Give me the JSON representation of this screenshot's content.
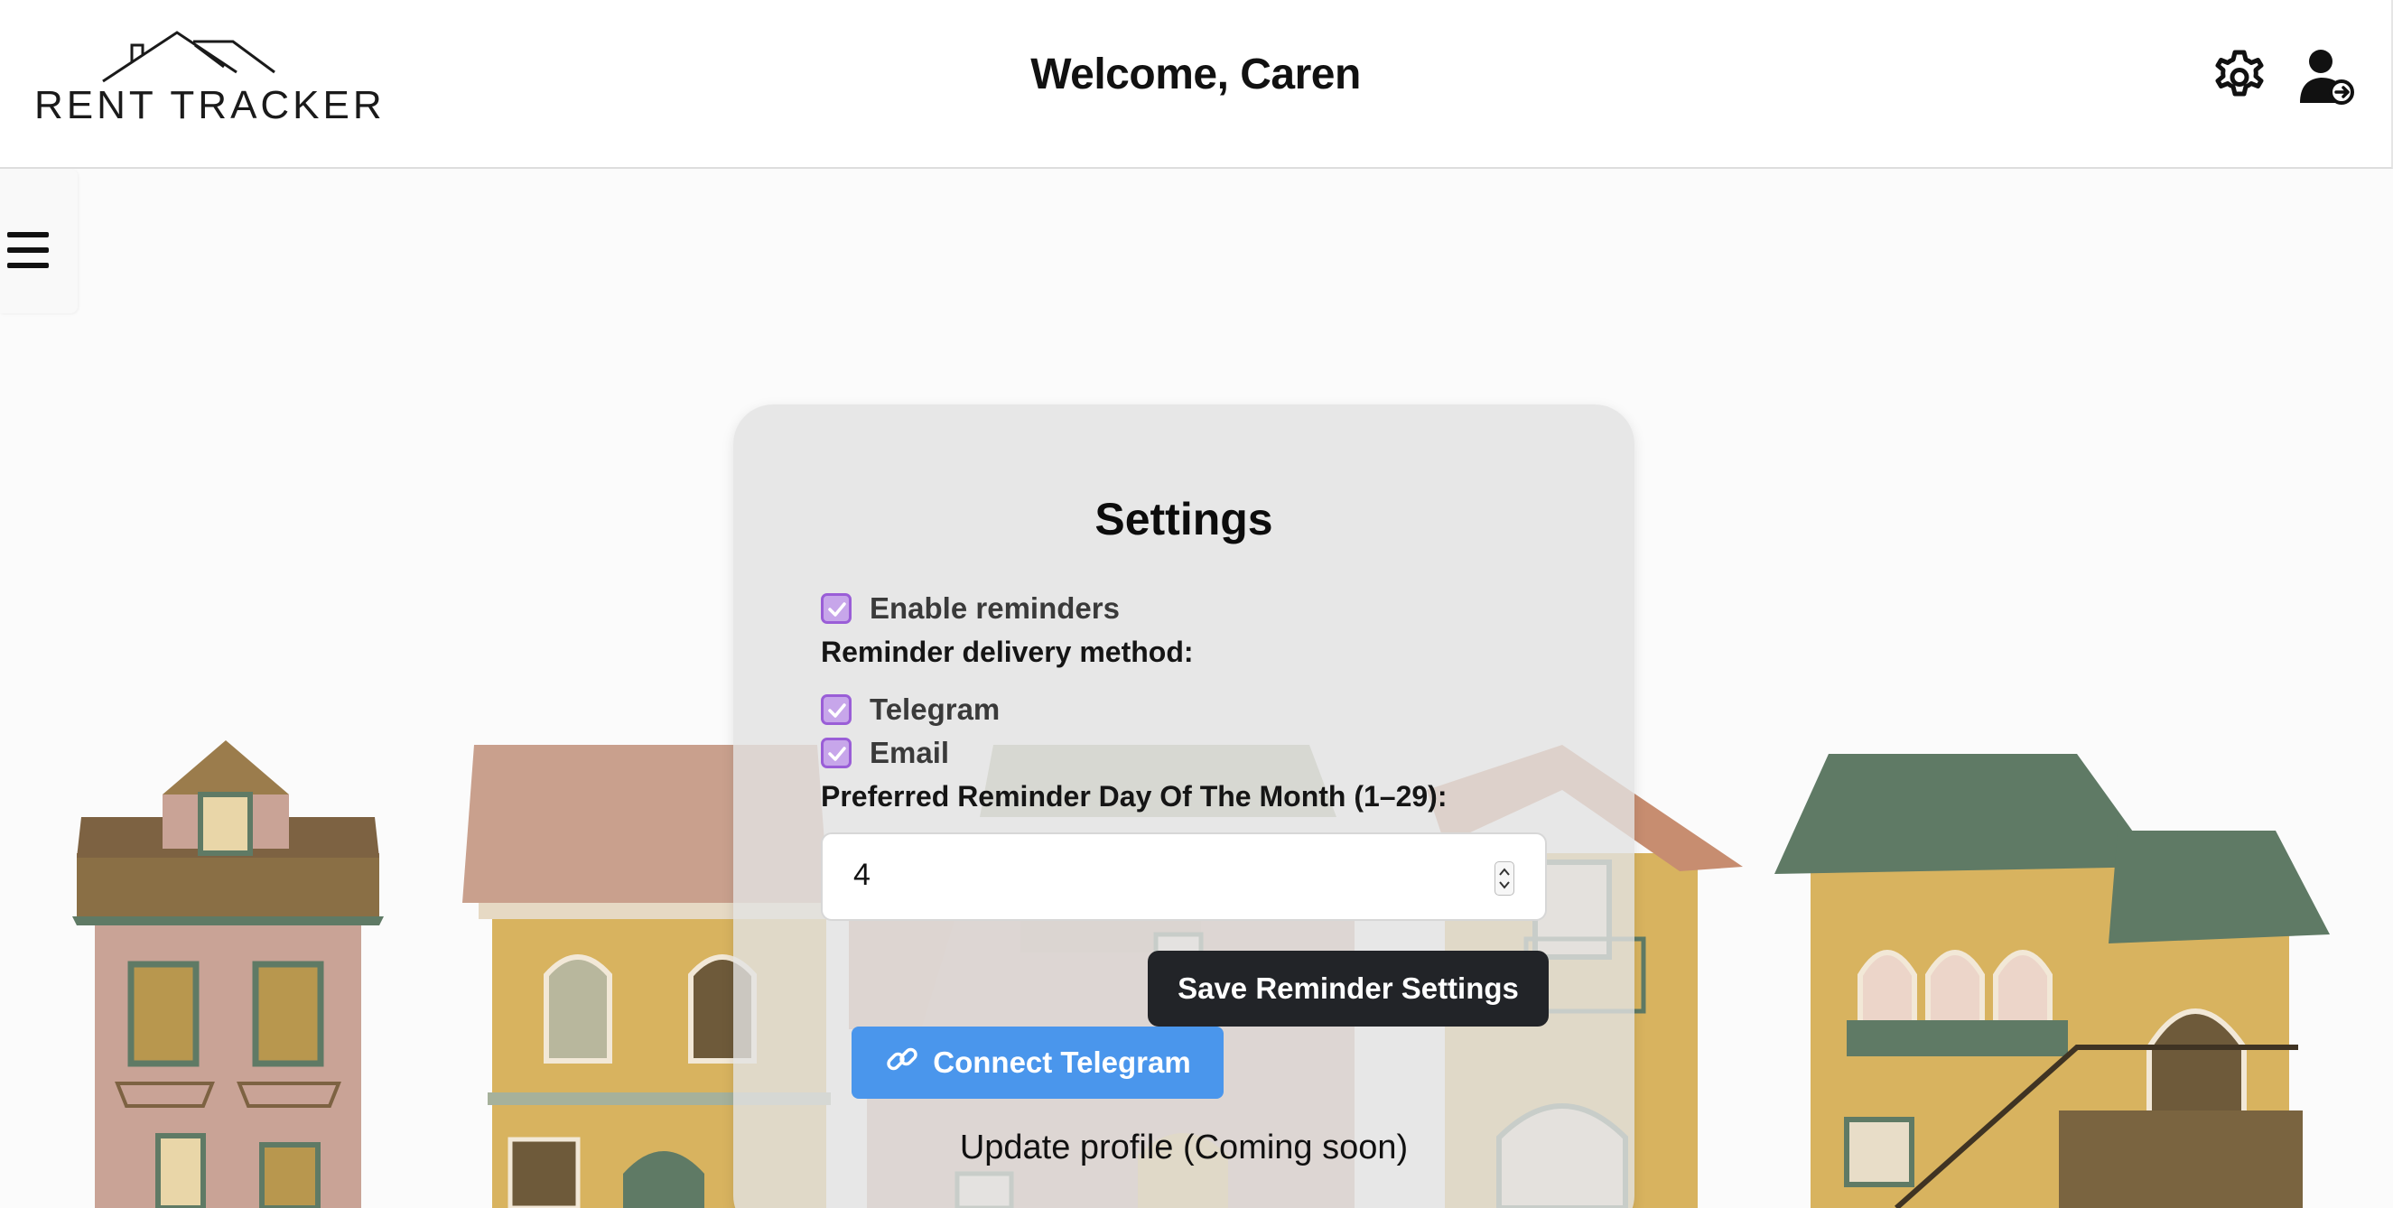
{
  "header": {
    "logo_text": "RENT TRACKER",
    "welcome": "Welcome, Caren",
    "settings_icon": "gear-icon",
    "logout_icon": "user-logout-icon"
  },
  "sidebar": {
    "toggle_icon": "hamburger-menu-icon"
  },
  "settings": {
    "title": "Settings",
    "enable_reminders": {
      "label": "Enable reminders",
      "checked": true
    },
    "delivery_label": "Reminder delivery method:",
    "methods": [
      {
        "label": "Telegram",
        "checked": true
      },
      {
        "label": "Email",
        "checked": true
      }
    ],
    "day_label": "Preferred Reminder Day Of The Month (1–29):",
    "day_value": "4",
    "save_label": "Save Reminder Settings",
    "telegram_label": "Connect Telegram",
    "telegram_icon": "link-icon",
    "update_profile": "Update profile (Coming soon)"
  },
  "colors": {
    "checkbox_fill": "#c7a6ea",
    "checkbox_border": "#9a5ed7",
    "save_button": "#222428",
    "telegram_button": "#4a96ec"
  }
}
